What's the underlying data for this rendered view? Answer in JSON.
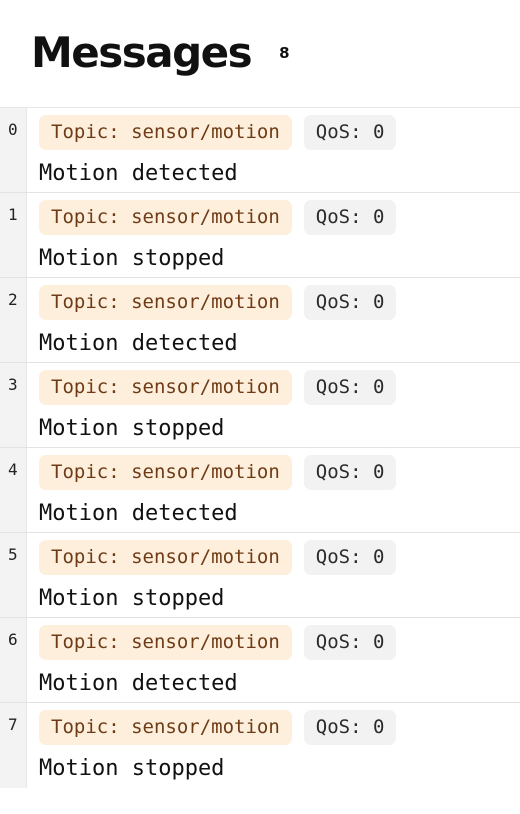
{
  "header": {
    "title": "Messages",
    "count": "8"
  },
  "messages": [
    {
      "index": "0",
      "topic": "Topic: sensor/motion",
      "qos": "QoS: 0",
      "payload": "Motion detected"
    },
    {
      "index": "1",
      "topic": "Topic: sensor/motion",
      "qos": "QoS: 0",
      "payload": "Motion stopped"
    },
    {
      "index": "2",
      "topic": "Topic: sensor/motion",
      "qos": "QoS: 0",
      "payload": "Motion detected"
    },
    {
      "index": "3",
      "topic": "Topic: sensor/motion",
      "qos": "QoS: 0",
      "payload": "Motion stopped"
    },
    {
      "index": "4",
      "topic": "Topic: sensor/motion",
      "qos": "QoS: 0",
      "payload": "Motion detected"
    },
    {
      "index": "5",
      "topic": "Topic: sensor/motion",
      "qos": "QoS: 0",
      "payload": "Motion stopped"
    },
    {
      "index": "6",
      "topic": "Topic: sensor/motion",
      "qos": "QoS: 0",
      "payload": "Motion detected"
    },
    {
      "index": "7",
      "topic": "Topic: sensor/motion",
      "qos": "QoS: 0",
      "payload": "Motion stopped"
    }
  ],
  "colors": {
    "topic_badge_bg": "#fdefdc",
    "topic_badge_text": "#6e3b16",
    "qos_badge_bg": "#f2f2f2",
    "gutter_bg": "#f3f3f3"
  }
}
